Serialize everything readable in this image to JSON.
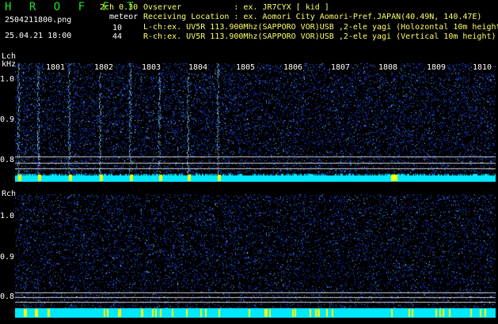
{
  "header": {
    "app_name": "H R O F F T",
    "version": "2ch 0.30",
    "filename": "2504211800.png",
    "datetime": "25.04.21 18:00",
    "meteor_label": "meteor",
    "count_l": "10",
    "count_r": "44",
    "observer": "Ovserver           : ex. JR7CYX [ kid ]",
    "location": "Receiving Location : ex. Aomori City Aomori-Pref.JAPAN(40.49N, 140.47E)",
    "lch_info": "L-ch:ex. UV5R 113.900Mhz(SAPPORO VOR)USB ,2-ele yagi (Holozontal 10m height)",
    "rch_info": "R-ch:ex. UV5R 113.900Mhz(SAPPORO VOR)USB ,2-ele yagi (Vertical 10m height)"
  },
  "lch": {
    "label": "Lch",
    "unit": "kHz",
    "yticks": [
      "1.0",
      "0.9",
      "0.8"
    ]
  },
  "rch": {
    "label": "Rch",
    "yticks": [
      "1.0",
      "0.9",
      "0.8"
    ]
  },
  "time_labels": [
    "1801",
    "1802",
    "1803",
    "1804",
    "1805",
    "1806",
    "1807",
    "1808",
    "1809",
    "1810"
  ],
  "colors": {
    "background": "#000000",
    "noise": "#1e3cd2",
    "baseline": "#00ffff",
    "meteor": "#ffff00",
    "title": "#22e022"
  }
}
